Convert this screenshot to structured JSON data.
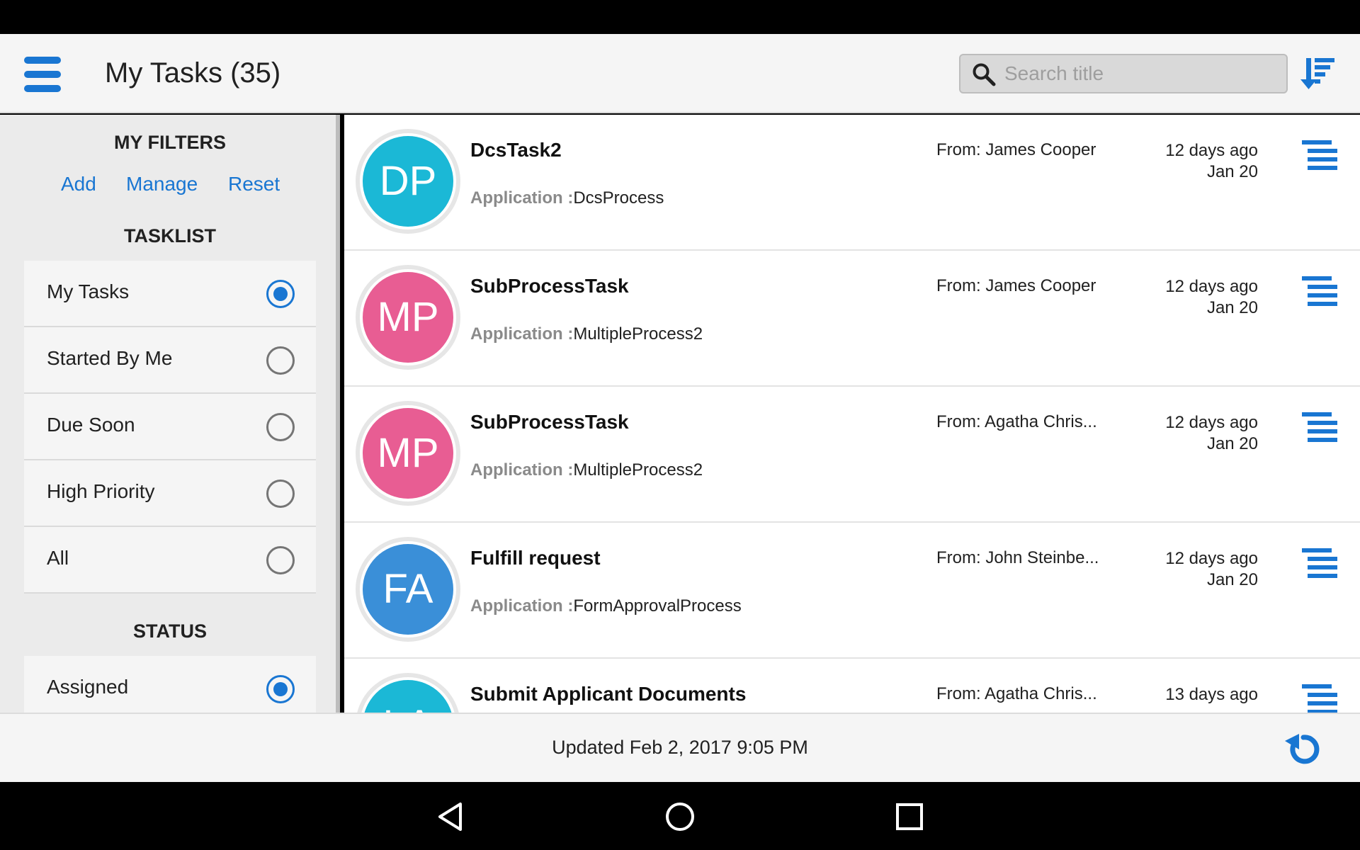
{
  "header": {
    "title": "My Tasks (35)",
    "search_placeholder": "Search title"
  },
  "sidebar": {
    "filters_heading": "MY FILTERS",
    "filter_links": [
      "Add",
      "Manage",
      "Reset"
    ],
    "tasklist_heading": "TASKLIST",
    "tasklist_options": [
      {
        "label": "My Tasks",
        "selected": true
      },
      {
        "label": "Started By Me",
        "selected": false
      },
      {
        "label": "Due Soon",
        "selected": false
      },
      {
        "label": "High Priority",
        "selected": false
      },
      {
        "label": "All",
        "selected": false
      }
    ],
    "status_heading": "STATUS",
    "status_options": [
      {
        "label": "Assigned",
        "selected": true
      }
    ]
  },
  "tasks": [
    {
      "initials": "DP",
      "avatar_color": "#1bb8d6",
      "title": "DcsTask2",
      "app_label": "Application :",
      "app": "DcsProcess",
      "from": "From: James Cooper",
      "ago": "12 days ago",
      "date": "Jan 20"
    },
    {
      "initials": "MP",
      "avatar_color": "#e85d93",
      "title": "SubProcessTask",
      "app_label": "Application :",
      "app": "MultipleProcess2",
      "from": "From: James Cooper",
      "ago": "12 days ago",
      "date": "Jan 20"
    },
    {
      "initials": "MP",
      "avatar_color": "#e85d93",
      "title": "SubProcessTask",
      "app_label": "Application :",
      "app": "MultipleProcess2",
      "from": "From: Agatha Chris...",
      "ago": "12 days ago",
      "date": "Jan 20"
    },
    {
      "initials": "FA",
      "avatar_color": "#3a8fd8",
      "title": "Fulfill request",
      "app_label": "Application :",
      "app": "FormApprovalProcess",
      "from": "From: John Steinbe...",
      "ago": "12 days ago",
      "date": "Jan 20"
    },
    {
      "initials": "LA",
      "avatar_color": "#1bb8d6",
      "title": "Submit Applicant Documents",
      "app_label": "",
      "app": "",
      "from": "From: Agatha Chris...",
      "ago": "13 days ago",
      "date": ""
    }
  ],
  "footer": {
    "updated": "Updated Feb 2, 2017 9:05 PM"
  },
  "colors": {
    "accent": "#1976d2"
  }
}
